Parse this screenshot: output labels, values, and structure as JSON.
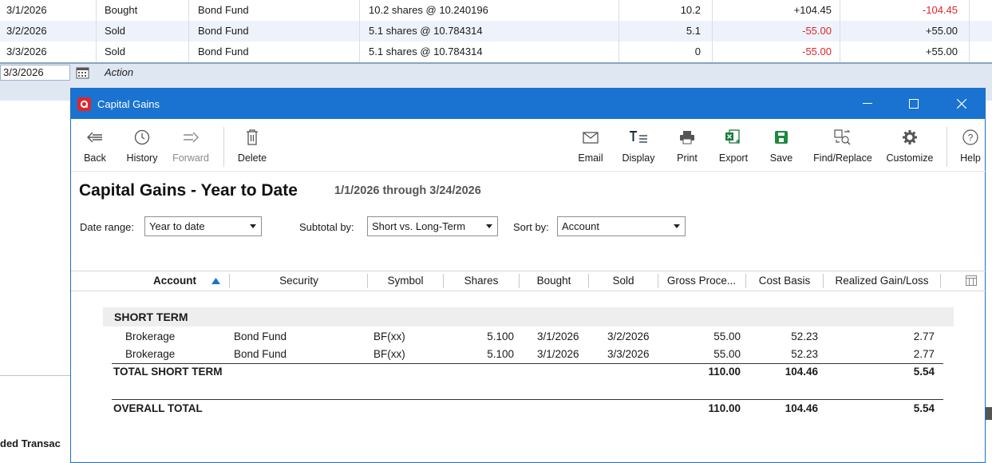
{
  "register": {
    "rows": [
      {
        "date": "3/1/2026",
        "action": "Bought",
        "security": "Bond Fund",
        "description": "10.2 shares @ 10.240196",
        "shares": "10.2",
        "amount": "+104.45",
        "cash": "-104.45"
      },
      {
        "date": "3/2/2026",
        "action": "Sold",
        "security": "Bond Fund",
        "description": "5.1 shares @ 10.784314",
        "shares": "5.1",
        "amount": "-55.00",
        "cash": "+55.00"
      },
      {
        "date": "3/3/2026",
        "action": "Sold",
        "security": "Bond Fund",
        "description": "5.1 shares @ 10.784314",
        "shares": "0",
        "amount": "-55.00",
        "cash": "+55.00"
      }
    ],
    "entry_date": "3/3/2026",
    "entry_action_placeholder": "Action",
    "bottom_text": "ded Transac"
  },
  "dialog": {
    "title": "Capital Gains",
    "toolbar": {
      "back": "Back",
      "history": "History",
      "forward": "Forward",
      "delete": "Delete",
      "email": "Email",
      "display": "Display",
      "print": "Print",
      "export": "Export",
      "save": "Save",
      "find_replace": "Find/Replace",
      "customize": "Customize",
      "help": "Help"
    },
    "report_title": "Capital Gains - Year to Date",
    "date_span": "1/1/2026 through 3/24/2026",
    "controls": {
      "date_range_label": "Date range:",
      "date_range_value": "Year to date",
      "subtotal_label": "Subtotal by:",
      "subtotal_value": "Short vs. Long-Term",
      "sort_label": "Sort by:",
      "sort_value": "Account"
    },
    "columns": [
      "Account",
      "Security",
      "Symbol",
      "Shares",
      "Bought",
      "Sold",
      "Gross Proce...",
      "Cost Basis",
      "Realized Gain/Loss"
    ],
    "section_title": "SHORT TERM",
    "rows": [
      {
        "account": "Brokerage",
        "security": "Bond Fund",
        "symbol": "BF(xx)",
        "shares": "5.100",
        "bought": "3/1/2026",
        "sold": "3/2/2026",
        "gross": "55.00",
        "basis": "52.23",
        "gain": "2.77"
      },
      {
        "account": "Brokerage",
        "security": "Bond Fund",
        "symbol": "BF(xx)",
        "shares": "5.100",
        "bought": "3/1/2026",
        "sold": "3/3/2026",
        "gross": "55.00",
        "basis": "52.23",
        "gain": "2.77"
      }
    ],
    "total_short": {
      "label": "TOTAL SHORT TERM",
      "gross": "110.00",
      "basis": "104.46",
      "gain": "5.54"
    },
    "overall": {
      "label": "OVERALL TOTAL",
      "gross": "110.00",
      "basis": "104.46",
      "gain": "5.54"
    }
  },
  "colors": {
    "titlebar": "#1a73d0",
    "negative": "#e0252b",
    "app_icon": "#e0252b"
  }
}
